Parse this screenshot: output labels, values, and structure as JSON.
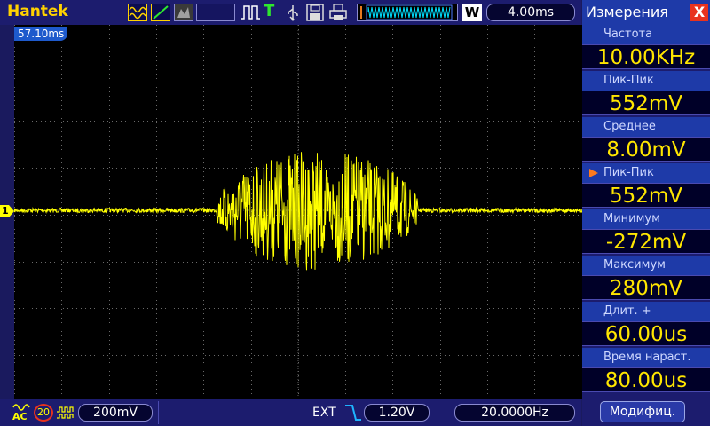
{
  "header": {
    "brand": "Hantek",
    "trigger_status": "T",
    "time_offset": "4.00ms",
    "time_offset_marker": "57.10ms",
    "memory_letter": "W"
  },
  "channel": {
    "number": "1",
    "coupling": "AC",
    "probe": "20",
    "volts_div": "200mV"
  },
  "trigger": {
    "source": "EXT",
    "level": "1.20V",
    "frequency": "20.0000Hz"
  },
  "measurements": {
    "title": "Измерения",
    "close_glyph": "X",
    "items": [
      {
        "label": "Частота",
        "value": "10.00KHz"
      },
      {
        "label": "Пик-Пик",
        "value": "552mV"
      },
      {
        "label": "Среднее",
        "value": "8.00mV"
      },
      {
        "label": "Пик-Пик",
        "value": "552mV"
      },
      {
        "label": "Минимум",
        "value": "-272mV"
      },
      {
        "label": "Максимум",
        "value": "280mV"
      },
      {
        "label": "Длит.  +",
        "value": "60.00us"
      },
      {
        "label": "Время  нараст.",
        "value": "80.00us"
      }
    ],
    "selected_index": 3,
    "modify_button": "Модифиц."
  },
  "colors": {
    "trace": "#ffff00",
    "brand": "#ffd200",
    "panel": "#1c1c6e",
    "label_bg": "#1e3aa8",
    "value": "#ffe600"
  }
}
